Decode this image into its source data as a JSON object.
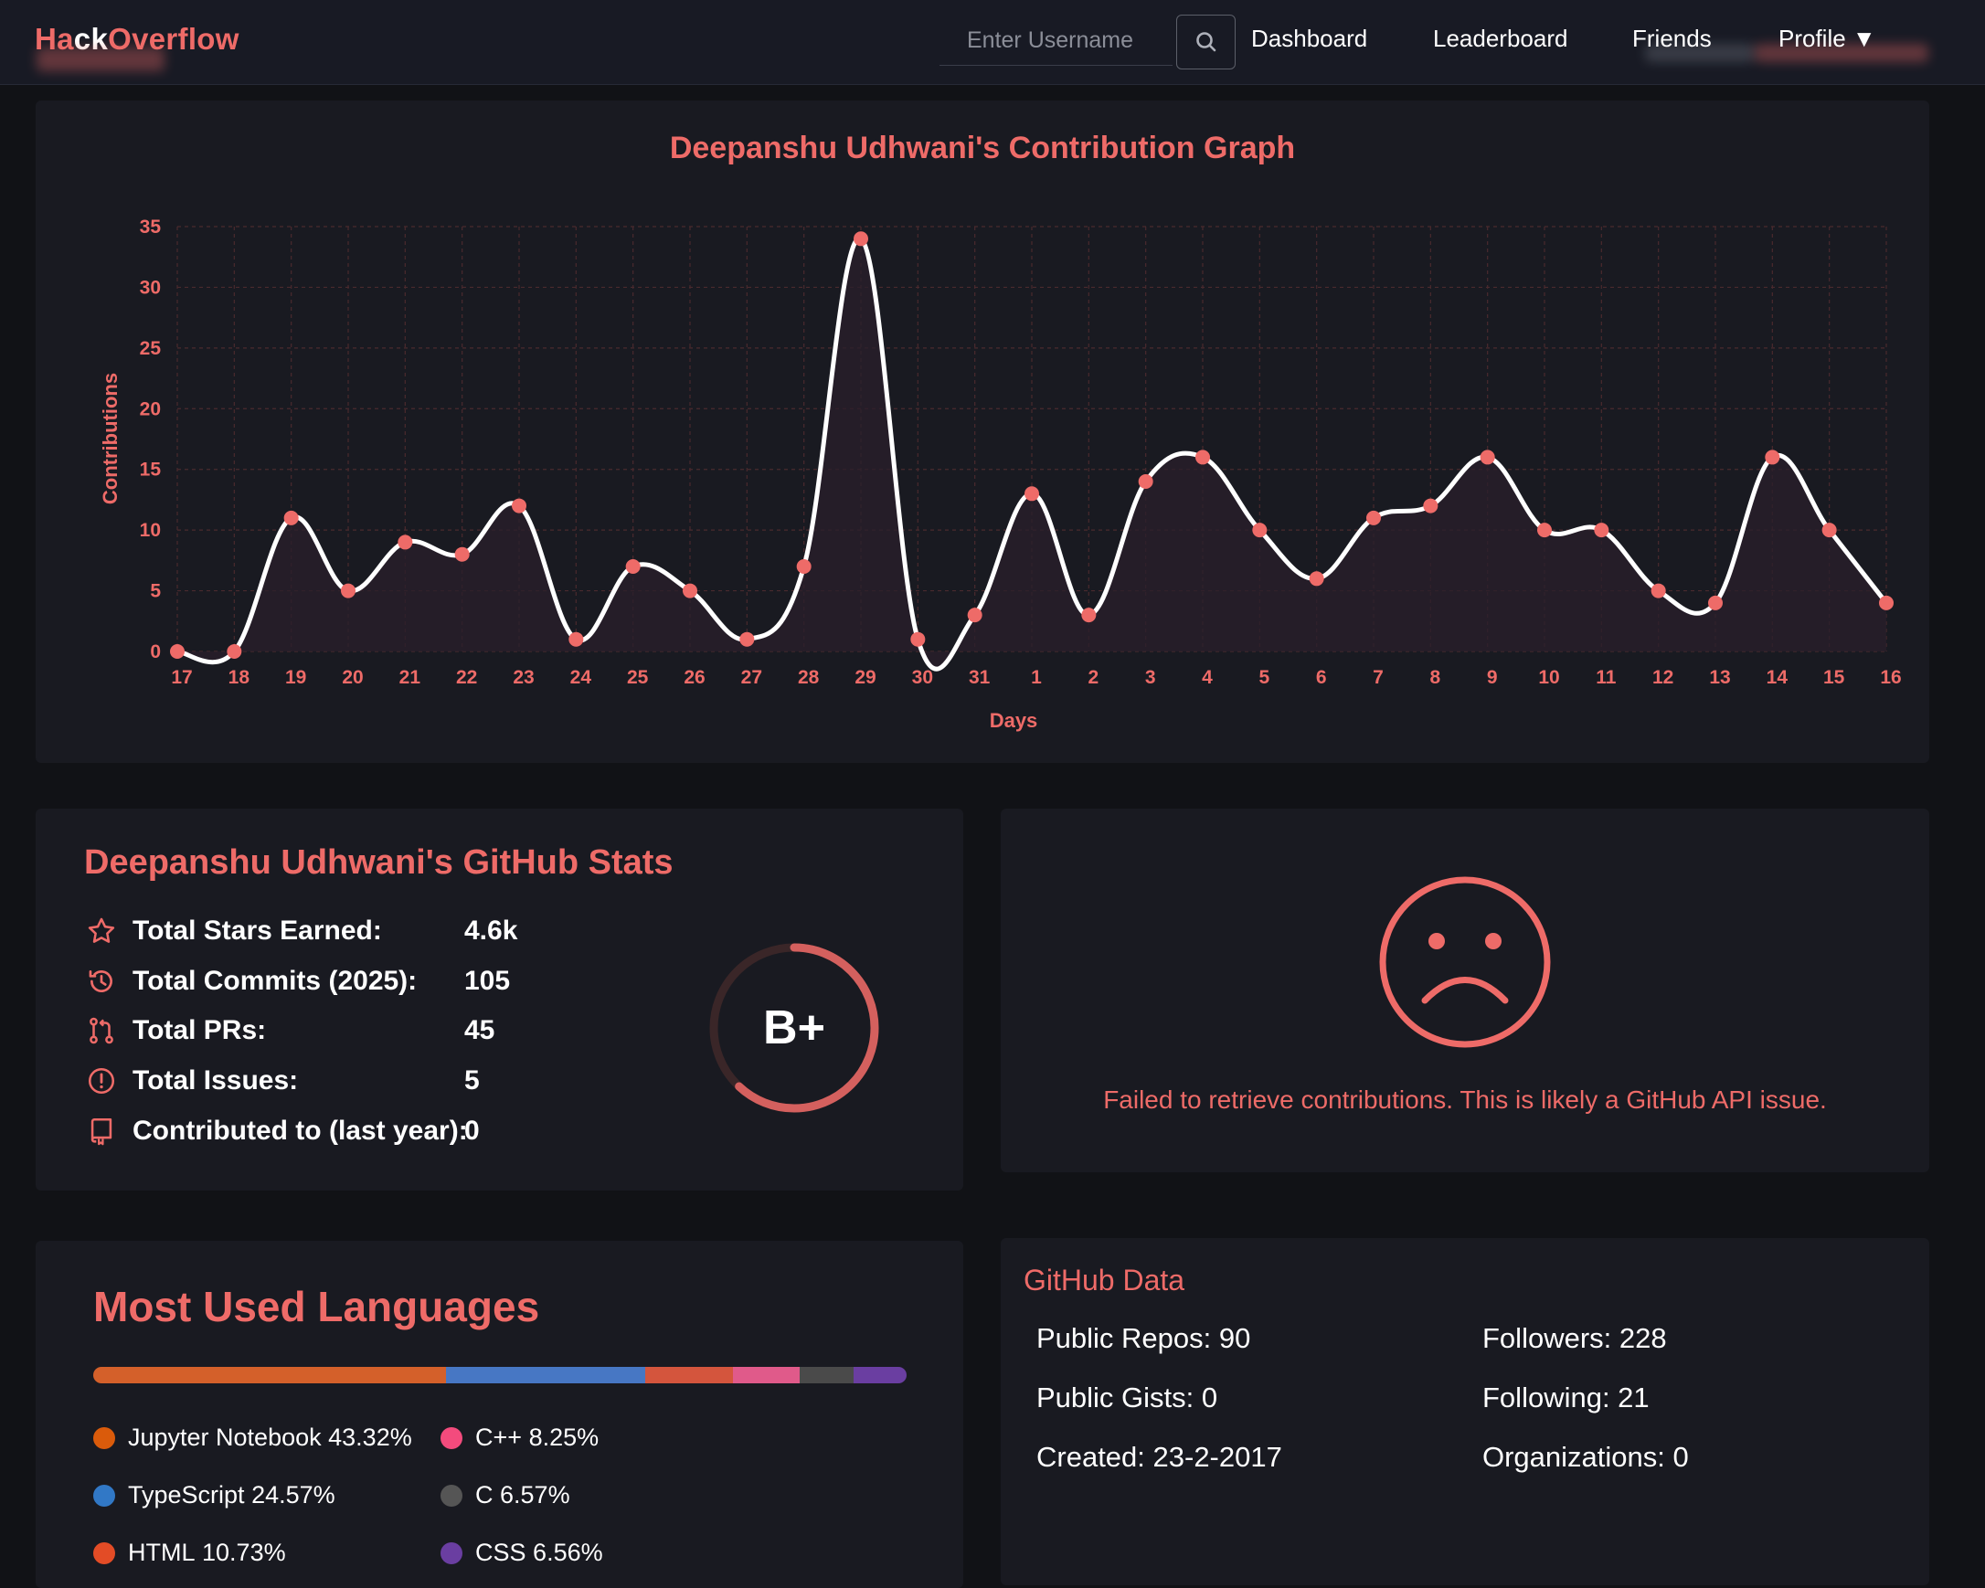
{
  "navbar": {
    "brand": [
      {
        "text": "Ha",
        "tone": "r"
      },
      {
        "text": "ck",
        "tone": "w"
      },
      {
        "text": "Over",
        "tone": "r"
      },
      {
        "text": "flow",
        "tone": "w"
      }
    ],
    "search_placeholder": "Enter Username",
    "links": {
      "dashboard": "Dashboard",
      "leaderboard": "Leaderboard",
      "friends": "Friends",
      "profile": "Profile ▼"
    }
  },
  "contribution_graph": {
    "title": "Deepanshu Udhwani's Contribution Graph",
    "chart_data": {
      "type": "line",
      "title": "Deepanshu Udhwani's Contribution Graph",
      "xlabel": "Days",
      "ylabel": "Contributions",
      "categories": [
        "17",
        "18",
        "19",
        "20",
        "21",
        "22",
        "23",
        "24",
        "25",
        "26",
        "27",
        "28",
        "29",
        "30",
        "31",
        "1",
        "2",
        "3",
        "4",
        "5",
        "6",
        "7",
        "8",
        "9",
        "10",
        "11",
        "12",
        "13",
        "14",
        "15",
        "16"
      ],
      "values": [
        0,
        0,
        11,
        5,
        9,
        8,
        12,
        1,
        7,
        5,
        1,
        7,
        34,
        1,
        3,
        13,
        3,
        14,
        16,
        10,
        6,
        11,
        12,
        16,
        10,
        10,
        5,
        4,
        16,
        10,
        4
      ],
      "ylim": [
        0,
        35
      ],
      "yticks": [
        0,
        5,
        10,
        15,
        20,
        25,
        30,
        35
      ],
      "grid": true
    }
  },
  "stats": {
    "title": "Deepanshu Udhwani's GitHub Stats",
    "rows": [
      {
        "icon": "star-icon",
        "label": "Total Stars Earned:",
        "value": "4.6k"
      },
      {
        "icon": "history-icon",
        "label": "Total Commits (2025):",
        "value": "105"
      },
      {
        "icon": "pull-request-icon",
        "label": "Total PRs:",
        "value": "45"
      },
      {
        "icon": "issue-icon",
        "label": "Total Issues:",
        "value": "5"
      },
      {
        "icon": "repo-icon",
        "label": "Contributed to (last year):",
        "value": "0"
      }
    ],
    "grade": "B+",
    "grade_progress": 0.62
  },
  "error": {
    "message": "Failed to retrieve contributions. This is likely a GitHub API issue."
  },
  "languages": {
    "title": "Most Used Languages",
    "items": [
      {
        "name": "Jupyter Notebook",
        "percent": "43.32%",
        "value": 43.32,
        "color": "#DA5B0B"
      },
      {
        "name": "TypeScript",
        "percent": "24.57%",
        "value": 24.57,
        "color": "#3178C6"
      },
      {
        "name": "HTML",
        "percent": "10.73%",
        "value": 10.73,
        "color": "#E34C26"
      },
      {
        "name": "C++",
        "percent": "8.25%",
        "value": 8.25,
        "color": "#F34B7D"
      },
      {
        "name": "C",
        "percent": "6.57%",
        "value": 6.57,
        "color": "#555555"
      },
      {
        "name": "CSS",
        "percent": "6.56%",
        "value": 6.56,
        "color": "#563D7C"
      }
    ]
  },
  "github_data": {
    "title": "GitHub Data",
    "public_repos": "Public Repos: 90",
    "public_gists": "Public Gists: 0",
    "created": "Created: 23-2-2017",
    "followers": "Followers: 228",
    "following": "Following: 21",
    "organizations": "Organizations: 0"
  },
  "colors": {
    "accent": "#ee6b68",
    "background": "#111216",
    "card": "#191a21",
    "navbar": "#181a24"
  }
}
